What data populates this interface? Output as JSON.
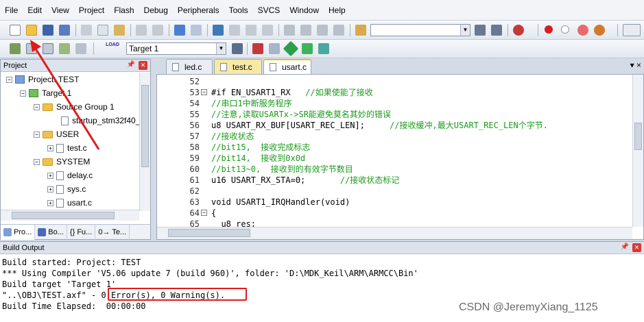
{
  "menu": [
    "File",
    "Edit",
    "View",
    "Project",
    "Flash",
    "Debug",
    "Peripherals",
    "Tools",
    "SVCS",
    "Window",
    "Help"
  ],
  "toolbar2": {
    "target_select": "Target 1",
    "load_label": "LOAD"
  },
  "project_panel": {
    "title": "Project",
    "tree": [
      {
        "label": "Project: TEST",
        "toggle": "−",
        "icon": "project-icon"
      },
      {
        "label": "Target 1",
        "toggle": "−",
        "icon": "target-icon"
      },
      {
        "label": "Source Group 1",
        "toggle": "−",
        "icon": "folder-icon"
      },
      {
        "label": "startup_stm32f40_",
        "toggle": "",
        "icon": "file-icon"
      },
      {
        "label": "USER",
        "toggle": "−",
        "icon": "folder-icon"
      },
      {
        "label": "test.c",
        "toggle": "+",
        "icon": "file-icon"
      },
      {
        "label": "SYSTEM",
        "toggle": "−",
        "icon": "folder-icon"
      },
      {
        "label": "delay.c",
        "toggle": "+",
        "icon": "file-icon"
      },
      {
        "label": "sys.c",
        "toggle": "+",
        "icon": "file-icon"
      },
      {
        "label": "usart.c",
        "toggle": "+",
        "icon": "file-icon"
      }
    ],
    "tabs": [
      "Pro...",
      "Bo...",
      "{} Fu...",
      "0→ Te..."
    ]
  },
  "editor": {
    "tabs": [
      "led.c",
      "test.c",
      "usart.c"
    ],
    "active_tab": "usart.c",
    "ctrl_close": "▾ ×",
    "lines": [
      {
        "n": "52",
        "fold": "",
        "code": ""
      },
      {
        "n": "53",
        "fold": "−",
        "code": "#if EN_USART1_RX   //如果使能了接收"
      },
      {
        "n": "54",
        "fold": "",
        "code": "//串口1中断服务程序"
      },
      {
        "n": "55",
        "fold": "",
        "code": "//注意,读取USARTx->SR能避免莫名其妙的错误"
      },
      {
        "n": "56",
        "fold": "",
        "code": "u8 USART_RX_BUF[USART_REC_LEN];     //接收缓冲,最大USART_REC_LEN个字节."
      },
      {
        "n": "57",
        "fold": "",
        "code": "//接收状态"
      },
      {
        "n": "58",
        "fold": "",
        "code": "//bit15,  接收完成标志"
      },
      {
        "n": "59",
        "fold": "",
        "code": "//bit14,  接收到0x0d"
      },
      {
        "n": "60",
        "fold": "",
        "code": "//bit13~0,  接收到的有效字节数目"
      },
      {
        "n": "61",
        "fold": "",
        "code": "u16 USART_RX_STA=0;       //接收状态标记"
      },
      {
        "n": "62",
        "fold": "",
        "code": ""
      },
      {
        "n": "63",
        "fold": "",
        "code": "void USART1_IRQHandler(void)"
      },
      {
        "n": "64",
        "fold": "−",
        "code": "{"
      },
      {
        "n": "65",
        "fold": "",
        "code": "  u8 res;"
      }
    ]
  },
  "build_output": {
    "title": "Build Output",
    "lines": [
      "Build started: Project: TEST",
      "*** Using Compiler 'V5.06 update 7 (build 960)', folder: 'D:\\MDK_Keil\\ARM\\ARMCC\\Bin'",
      "Build target 'Target 1'",
      "\"..\\OBJ\\TEST.axf\" - 0 Error(s), 0 Warning(s).",
      "Build Time Elapsed:  00:00:00"
    ]
  },
  "watermark": "CSDN @JeremyXiang_1125",
  "colors": {
    "annotation": "#e01b1b",
    "comment": "#1c9a1c",
    "keyword": "#1a1aa6"
  }
}
